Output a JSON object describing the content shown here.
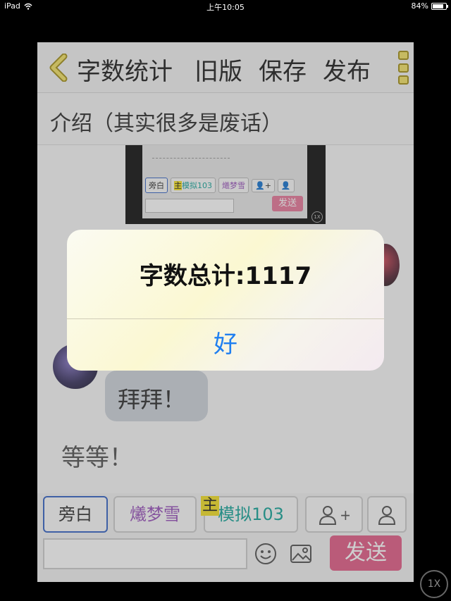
{
  "status_bar": {
    "device": "iPad",
    "time": "上午10:05",
    "battery": "84%",
    "battery_level": 0.84
  },
  "toolbar": {
    "back_icon": "chevron-left-icon",
    "word_count_label": "字数统计",
    "old_version_label": "旧版",
    "save_label": "保存",
    "publish_label": "发布",
    "menu_icon": "menu-icon"
  },
  "intro": {
    "label": "介绍（其实很多是废话）"
  },
  "chat": {
    "thumbnail": {
      "narration": "旁白",
      "master_badge": "主",
      "role_1": "模拟103",
      "role_2": "爔梦雪",
      "send": "发送",
      "zoom": "1X"
    },
    "bubble_text": "拜拜！",
    "narration_text": "等等！"
  },
  "bottom_bar": {
    "narration_button": "旁白",
    "role_1": "爔梦雪",
    "role_2": "模拟103",
    "master_badge": "主",
    "add_role_label": "+",
    "message_placeholder": "",
    "send_button": "发送",
    "colors": {
      "active_border": "#3a67c7",
      "send": "#e4608a",
      "role_purple": "#9a55bd",
      "role_teal": "#1aa79c"
    }
  },
  "alert": {
    "title": "字数总计:1117",
    "ok_button": "好",
    "ok_color": "#1f7ff0"
  },
  "zoom_button": "1X"
}
